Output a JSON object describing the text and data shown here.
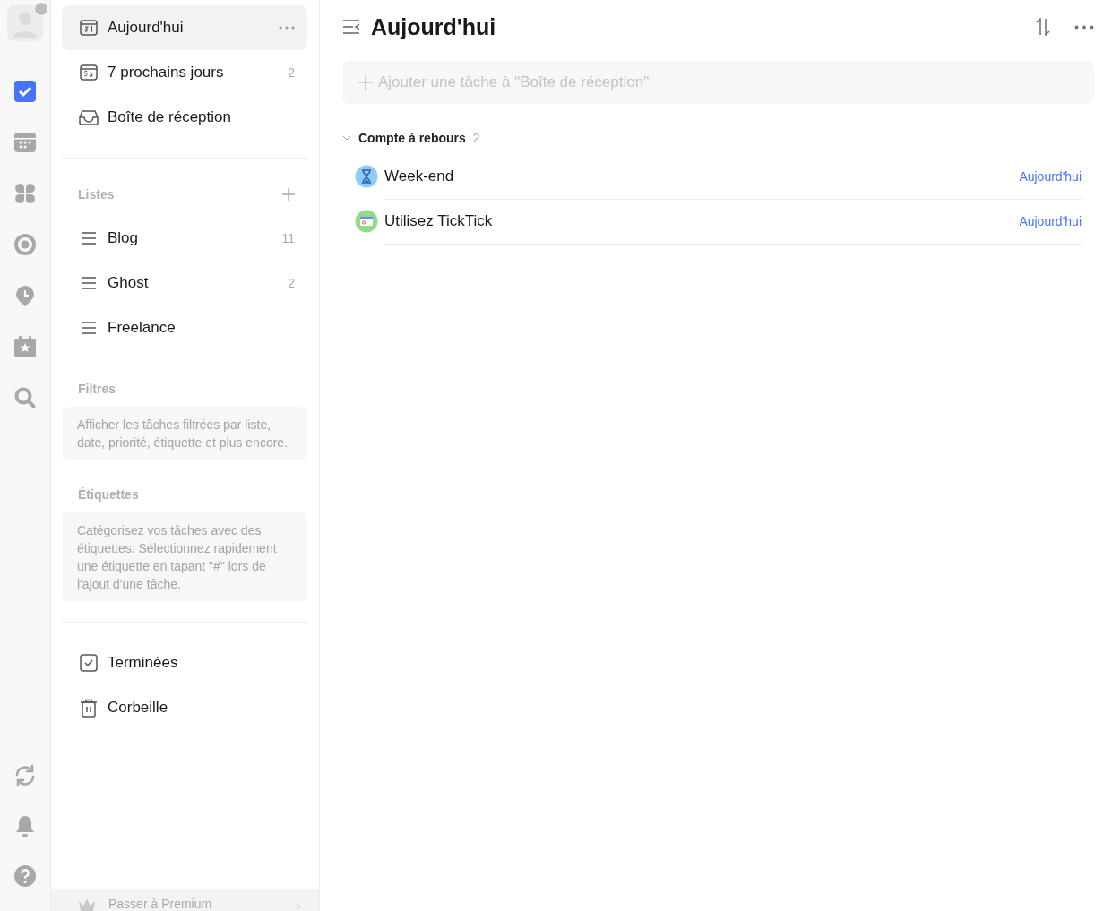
{
  "rail": {
    "avatar": {
      "badge": true
    },
    "items": [
      {
        "kind": "tasks",
        "selected": true
      },
      {
        "kind": "calendar",
        "selected": false
      },
      {
        "kind": "grid",
        "selected": false
      },
      {
        "kind": "focus",
        "selected": false
      },
      {
        "kind": "clock",
        "selected": false
      },
      {
        "kind": "event",
        "selected": false
      },
      {
        "kind": "search",
        "selected": false
      }
    ],
    "bottom": [
      {
        "kind": "sync"
      },
      {
        "kind": "bell"
      },
      {
        "kind": "help"
      }
    ]
  },
  "sidebar": {
    "smart": [
      {
        "kind": "today",
        "label": "Aujourd'hui",
        "selected": true
      },
      {
        "kind": "week",
        "label": "7 prochains jours",
        "selected": false,
        "count": "2"
      },
      {
        "kind": "inbox",
        "label": "Boîte de réception",
        "selected": false
      }
    ],
    "lists_title": "Listes",
    "lists": [
      {
        "label": "Blog",
        "count": "11"
      },
      {
        "label": "Ghost",
        "count": "2"
      },
      {
        "label": "Freelance"
      }
    ],
    "filters_title": "Filtres",
    "filters_hint": "Afficher les tâches filtrées par liste, date, priorité, étiquette et plus encore.",
    "tags_title": "Étiquettes",
    "tags_hint": "Catégorisez vos tâches avec des étiquettes. Sélectionnez rapidement une étiquette en tapant \"#\" lors de l'ajout d'une tâche.",
    "bottom": [
      {
        "kind": "done",
        "label": "Terminées"
      },
      {
        "kind": "trash",
        "label": "Corbeille"
      }
    ],
    "premium": "Passer à Premium"
  },
  "main": {
    "title": "Aujourd'hui",
    "add_task": {
      "placeholder": "Ajouter une tâche à \"Boîte de réception\""
    },
    "group": {
      "title": "Compte à rebours",
      "count": "2",
      "expanded": true
    },
    "tasks": [
      {
        "kind": "hourglass",
        "color": "#8ecbf7",
        "title": "Week-end",
        "date": "Aujourd'hui"
      },
      {
        "kind": "app",
        "color": "#8fdc8a",
        "title": "Utilisez TickTick",
        "date": "Aujourd'hui"
      }
    ]
  }
}
